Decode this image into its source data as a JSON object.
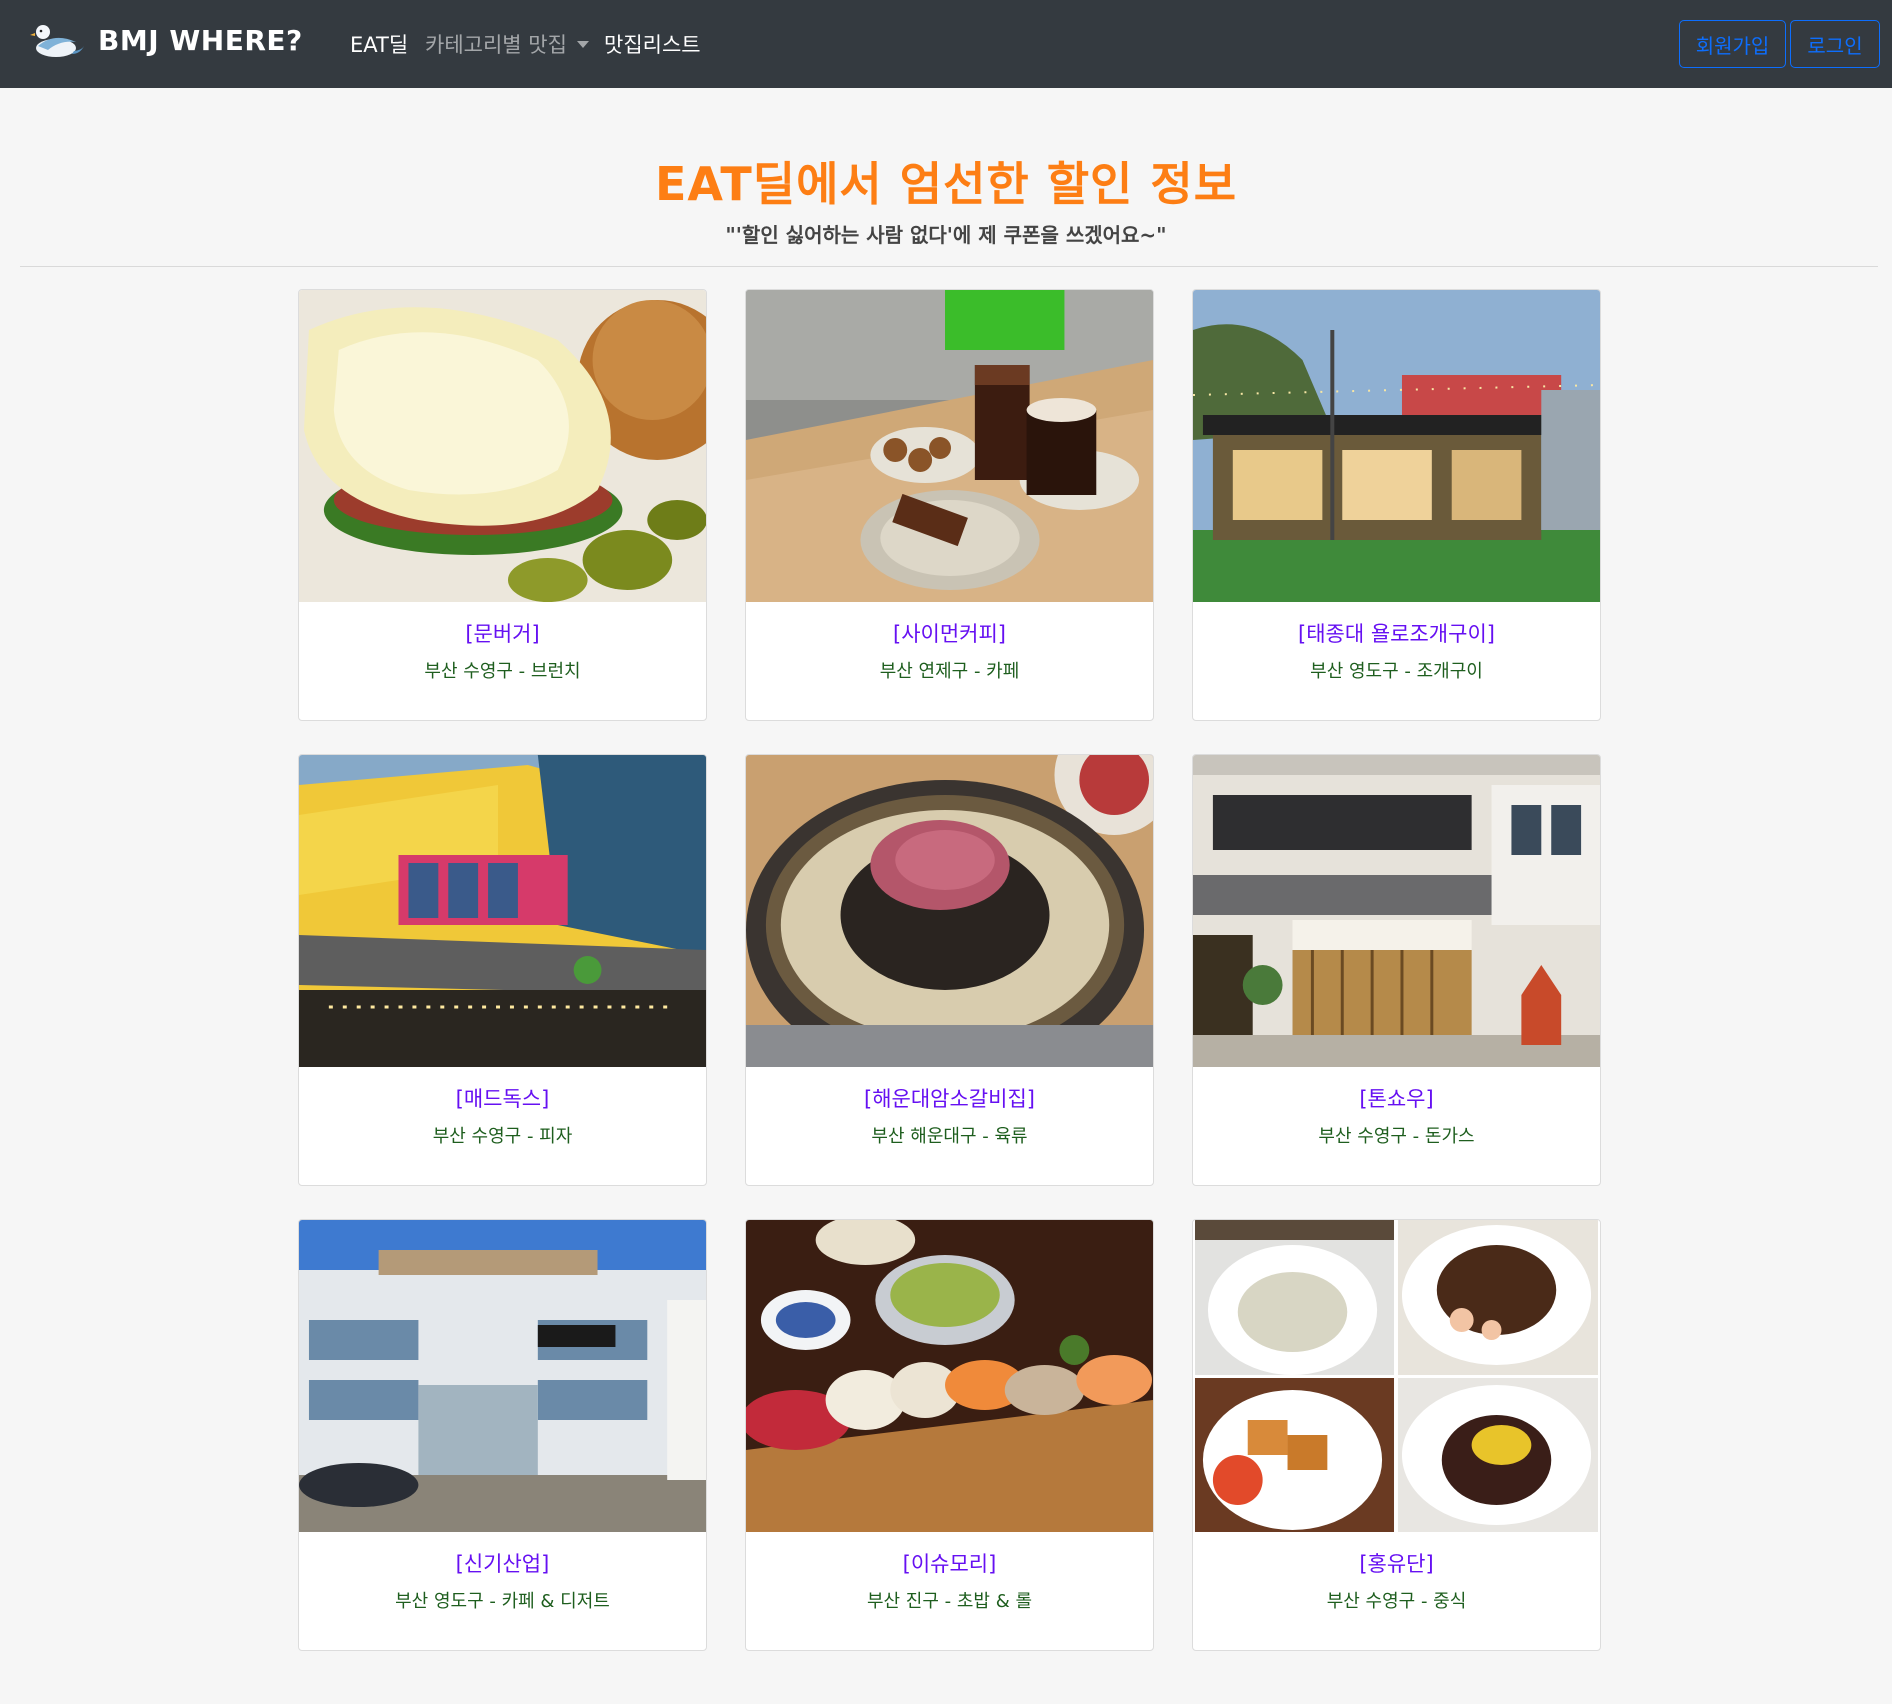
{
  "navbar": {
    "brand": "BMJ WHERE?",
    "links": [
      {
        "label": "EAT딜"
      },
      {
        "label": "카테고리별 맛집"
      },
      {
        "label": "맛집리스트"
      }
    ],
    "signup_label": "회원가입",
    "login_label": "로그인"
  },
  "header": {
    "title": "EAT딜에서 엄선한 할인 정보",
    "subtitle": "\"'할인 싫어하는 사람 없다'에 제 쿠폰을 쓰겠어요~\""
  },
  "cards": [
    {
      "name": "[문버거]",
      "info": "부산 수영구 - 브런치",
      "photo": "burger"
    },
    {
      "name": "[사이먼커피]",
      "info": "부산 연제구 - 카페",
      "photo": "coffee"
    },
    {
      "name": "[태종대 욜로조개구이]",
      "info": "부산 영도구 - 조개구이",
      "photo": "clam-bbq"
    },
    {
      "name": "[매드독스]",
      "info": "부산 수영구 - 피자",
      "photo": "pizza-building"
    },
    {
      "name": "[해운대암소갈비집]",
      "info": "부산 해운대구 - 육류",
      "photo": "beef-grill"
    },
    {
      "name": "[톤쇼우]",
      "info": "부산 수영구 - 돈가스",
      "photo": "tonkatsu-shop"
    },
    {
      "name": "[신기산업]",
      "info": "부산 영도구 - 카페 & 디저트",
      "photo": "cafe-building"
    },
    {
      "name": "[이슈모리]",
      "info": "부산 진구 - 초밥 & 롤",
      "photo": "sushi"
    },
    {
      "name": "[홍유단]",
      "info": "부산 수영구 - 중식",
      "photo": "chinese-dishes"
    }
  ],
  "colors": {
    "navbar_bg": "#343a40",
    "title": "#fd7e14",
    "card_title": "#6610f2",
    "card_text": "#1e5e1e",
    "button_outline": "#0d6efd"
  }
}
